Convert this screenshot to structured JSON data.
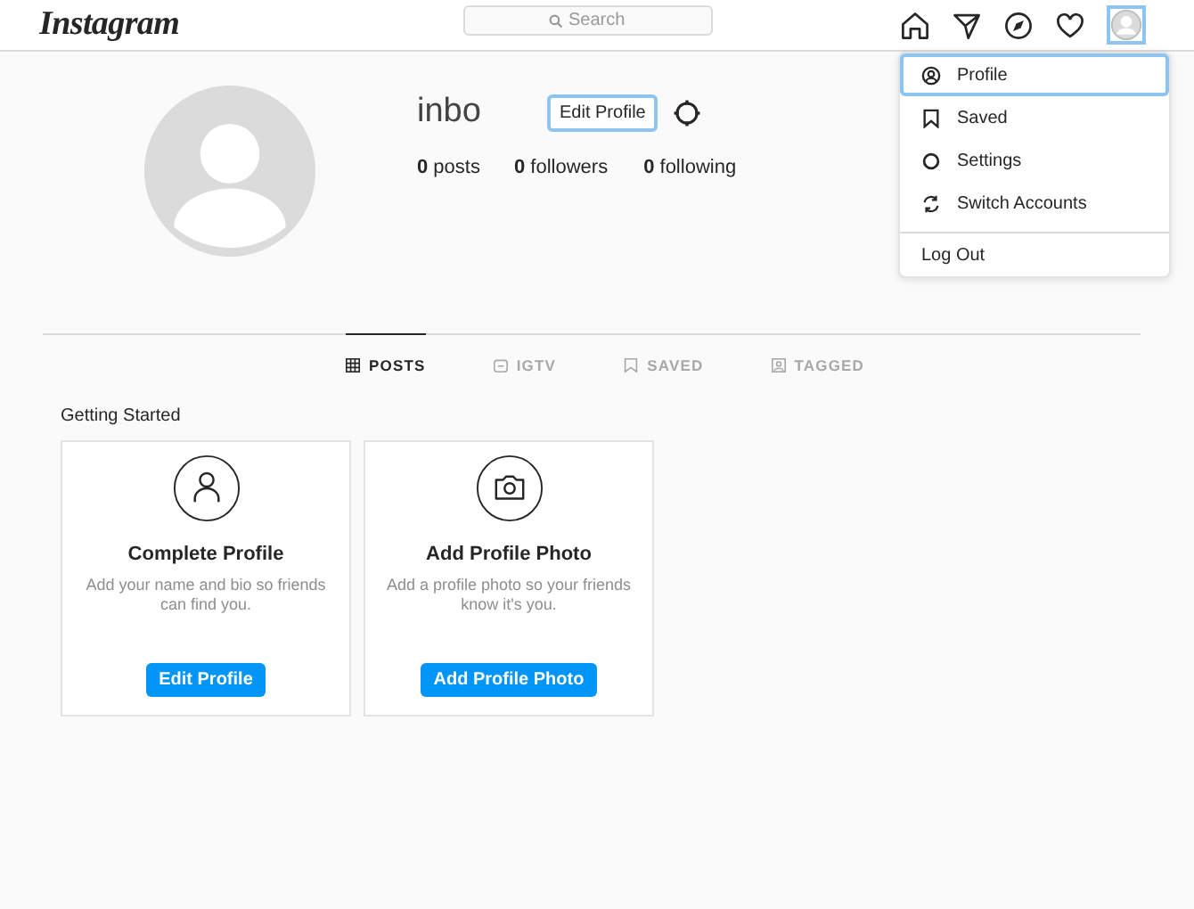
{
  "header": {
    "logo": "Instagram",
    "search": {
      "placeholder": "Search"
    },
    "account_menu_open": true
  },
  "account_menu": [
    {
      "label": "Profile",
      "kind": "profile",
      "selected": true
    },
    {
      "label": "Saved",
      "kind": "saved",
      "selected": false
    },
    {
      "label": "Settings",
      "kind": "settings",
      "selected": false
    },
    {
      "label": "Switch Accounts",
      "kind": "switch",
      "selected": false
    },
    {
      "label": "Log Out",
      "kind": "logout",
      "selected": false
    }
  ],
  "profile": {
    "username": "inbo",
    "edit_button": "Edit Profile",
    "stats": [
      {
        "count": "0",
        "label": "posts"
      },
      {
        "count": "0",
        "label": "followers"
      },
      {
        "count": "0",
        "label": "following"
      }
    ]
  },
  "tabs": [
    {
      "label": "POSTS",
      "kind": "grid",
      "selected": true
    },
    {
      "label": "IGTV",
      "kind": "tv",
      "selected": false
    },
    {
      "label": "SAVED",
      "kind": "saved",
      "selected": false
    },
    {
      "label": "TAGGED",
      "kind": "tagged",
      "selected": false
    }
  ],
  "getting_started": {
    "title": "Getting Started",
    "cards": [
      {
        "kind": "person",
        "title": "Complete Profile",
        "text": "Add your name and bio so friends can find you.",
        "button": "Edit Profile"
      },
      {
        "kind": "camera",
        "title": "Add Profile Photo",
        "text": "Add a profile photo so your friends know it's you.",
        "button": "Add Profile Photo"
      }
    ]
  }
}
